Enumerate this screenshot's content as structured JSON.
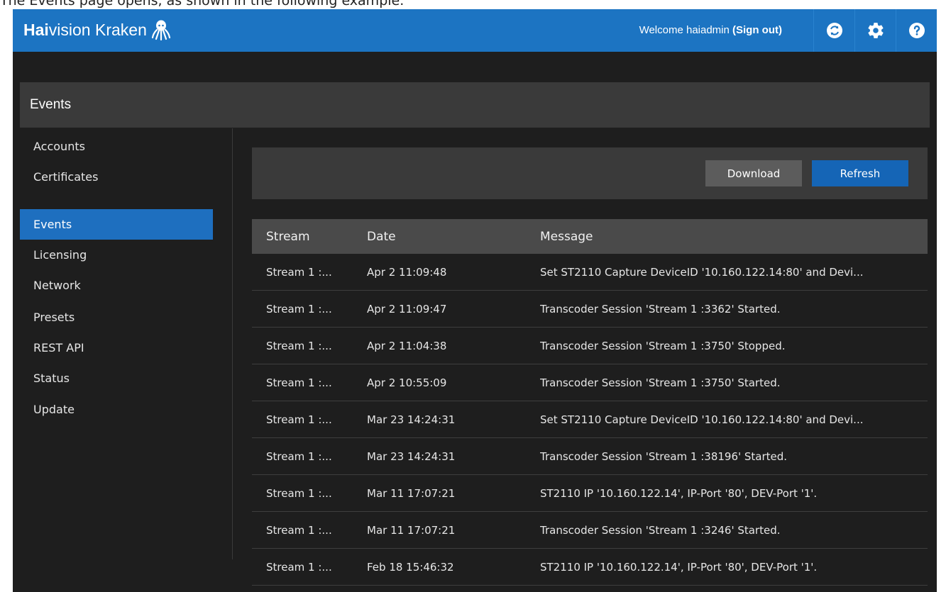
{
  "caption": "The Events page opens, as shown in the following example.",
  "header": {
    "brand_bold": "Hai",
    "brand_rest": "vision Kraken",
    "welcome_text": "Welcome haiadmin ",
    "signout_label": "(Sign out)",
    "icons": [
      "sync-icon",
      "gear-icon",
      "help-icon"
    ],
    "color": "#1c74c2"
  },
  "page": {
    "title": "Events"
  },
  "sidebar": {
    "items": [
      {
        "label": "Accounts",
        "active": false
      },
      {
        "label": "Certificates",
        "active": false
      },
      {
        "label": "Events",
        "active": true
      },
      {
        "label": "Licensing",
        "active": false
      },
      {
        "label": "Network",
        "active": false
      },
      {
        "label": "Presets",
        "active": false
      },
      {
        "label": "REST API",
        "active": false
      },
      {
        "label": "Status",
        "active": false
      },
      {
        "label": "Update",
        "active": false
      }
    ]
  },
  "toolbar": {
    "download_label": "Download",
    "refresh_label": "Refresh"
  },
  "table": {
    "headers": [
      "Stream",
      "Date",
      "Message"
    ],
    "rows": [
      [
        "Stream 1 :...",
        "Apr 2 11:09:48",
        "Set ST2110 Capture DeviceID '10.160.122.14:80' and Devi..."
      ],
      [
        "Stream 1 :...",
        "Apr 2 11:09:47",
        "Transcoder Session 'Stream 1 :3362' Started."
      ],
      [
        "Stream 1 :...",
        "Apr 2 11:04:38",
        "Transcoder Session 'Stream 1 :3750' Stopped."
      ],
      [
        "Stream 1 :...",
        "Apr 2 10:55:09",
        "Transcoder Session 'Stream 1 :3750' Started."
      ],
      [
        "Stream 1 :...",
        "Mar 23 14:24:31",
        "Set ST2110 Capture DeviceID '10.160.122.14:80' and Devi..."
      ],
      [
        "Stream 1 :...",
        "Mar 23 14:24:31",
        "Transcoder Session 'Stream 1 :38196' Started."
      ],
      [
        "Stream 1 :...",
        "Mar 11 17:07:21",
        "ST2110 IP '10.160.122.14', IP-Port '80', DEV-Port '1'."
      ],
      [
        "Stream 1 :...",
        "Mar 11 17:07:21",
        "Transcoder Session 'Stream 1 :3246' Started."
      ],
      [
        "Stream 1 :...",
        "Feb 18 15:46:32",
        "ST2110 IP '10.160.122.14', IP-Port '80', DEV-Port '1'."
      ]
    ]
  }
}
